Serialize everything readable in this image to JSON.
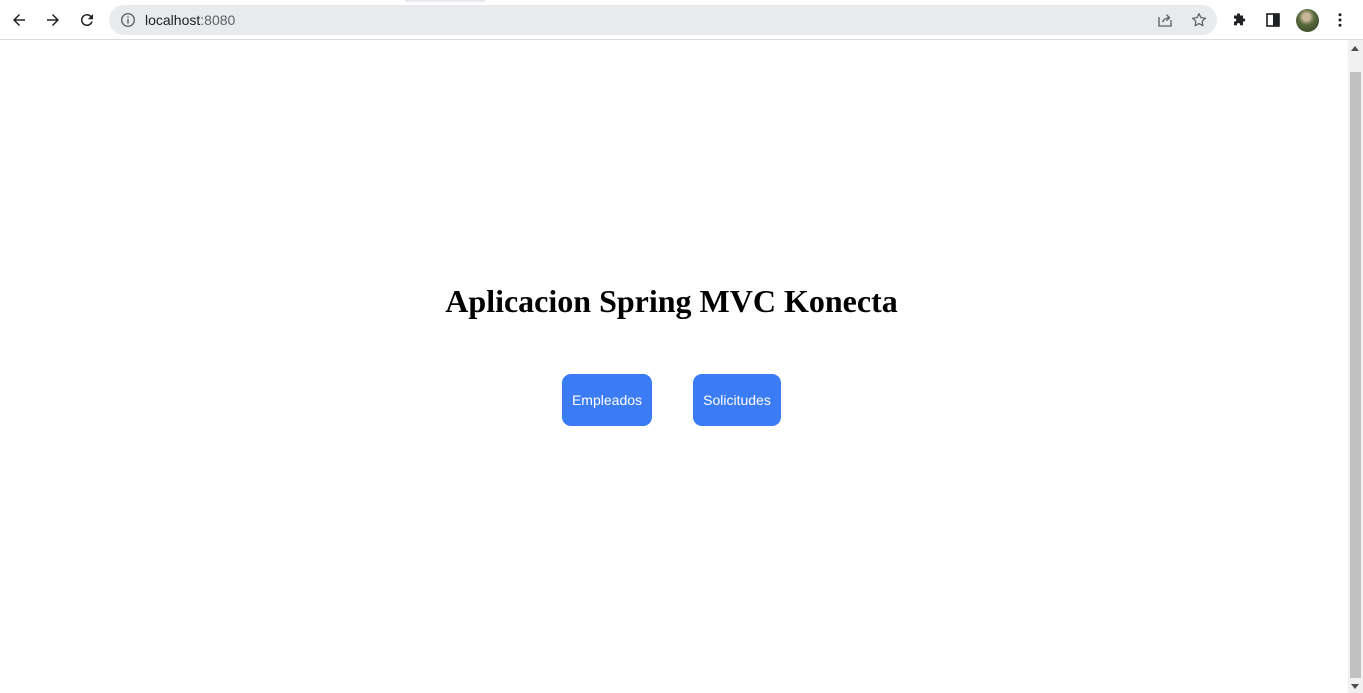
{
  "browser": {
    "url_host": "localhost",
    "url_port": ":8080",
    "icons": {
      "back": "back-arrow-icon",
      "forward": "forward-arrow-icon",
      "reload": "reload-icon",
      "site_info": "info-icon",
      "share": "share-icon",
      "bookmark": "star-icon",
      "extensions": "puzzle-icon",
      "side_panel": "side-panel-icon",
      "menu": "kebab-menu-icon"
    }
  },
  "page": {
    "title": "Aplicacion Spring MVC Konecta",
    "buttons": [
      {
        "label": "Empleados"
      },
      {
        "label": "Solicitudes"
      }
    ],
    "colors": {
      "button_bg": "#3b7cf4",
      "button_text": "#ffffff"
    }
  }
}
